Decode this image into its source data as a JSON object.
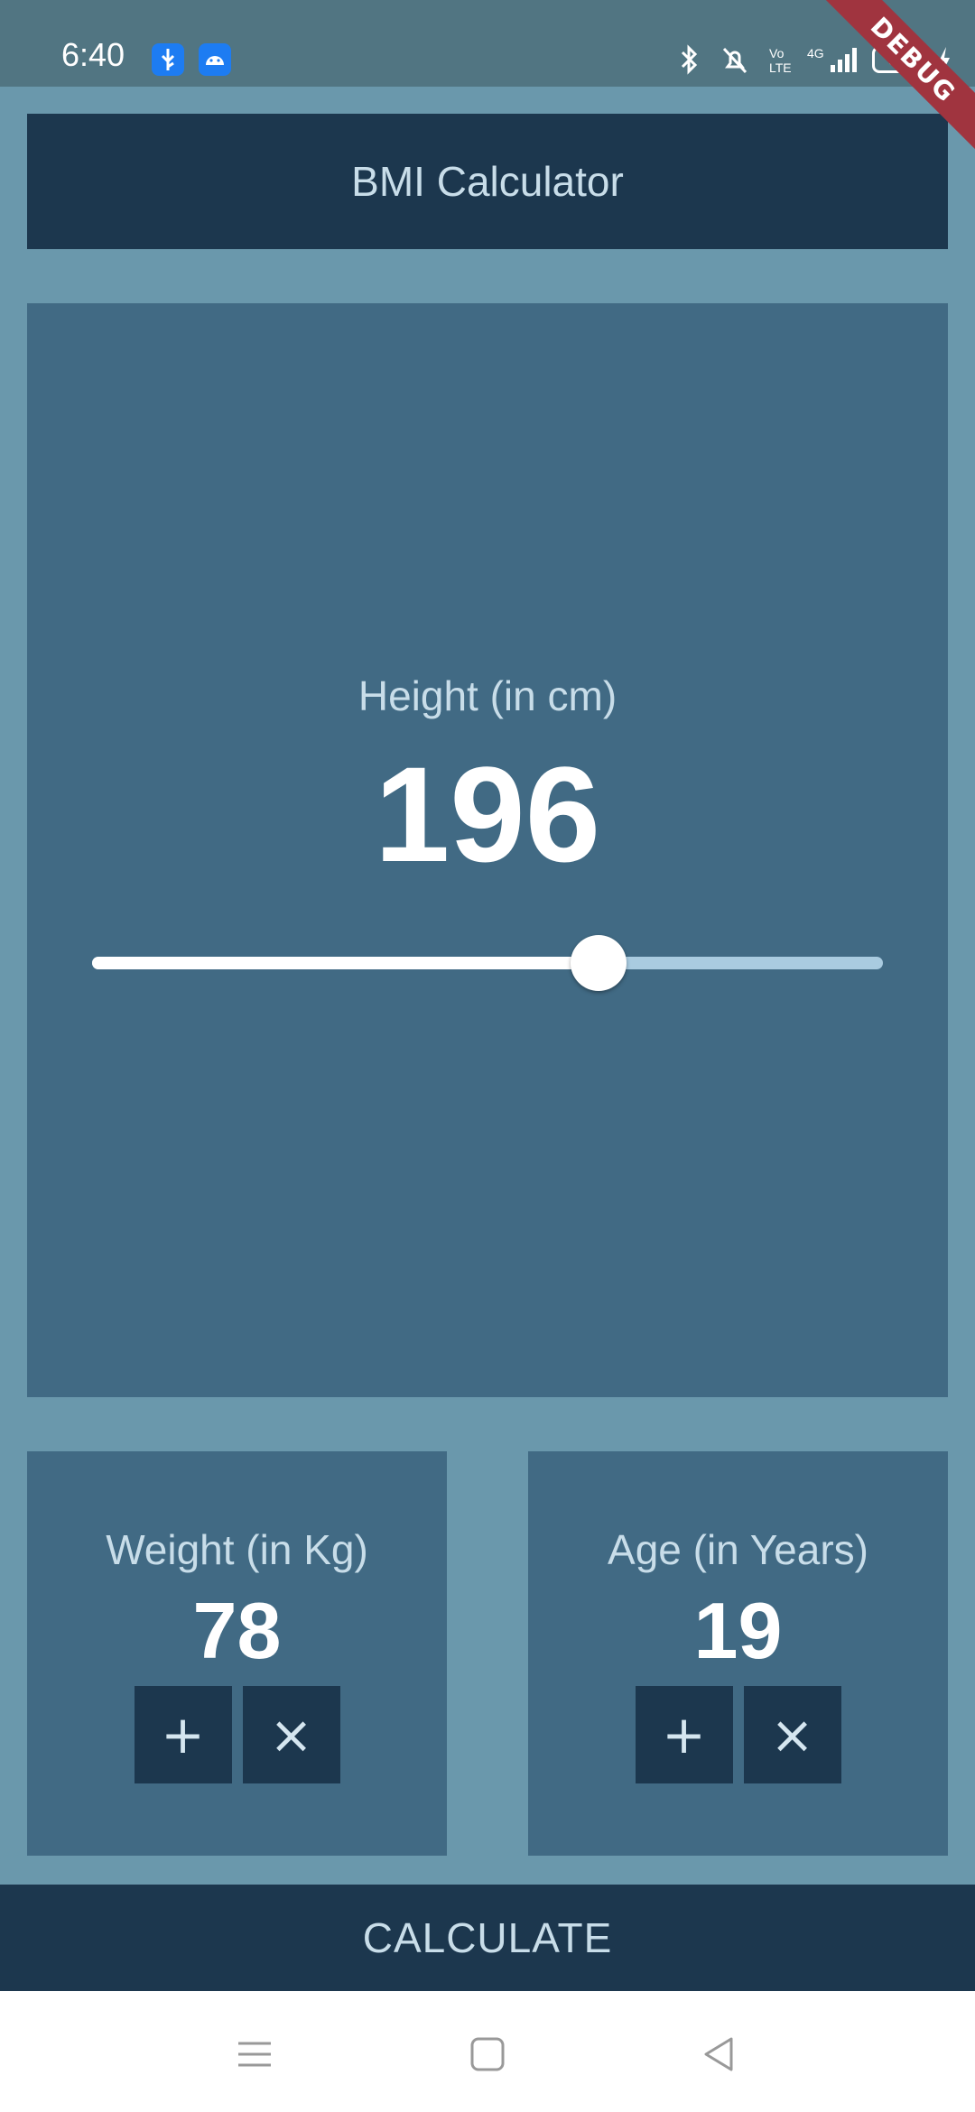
{
  "status_bar": {
    "time": "6:40",
    "battery": "52",
    "icons": [
      "usb-icon",
      "android-icon",
      "bluetooth-icon",
      "mute-icon",
      "volte-icon",
      "4g-signal-icon",
      "battery-icon"
    ]
  },
  "debug_banner": "DEBUG",
  "app_bar": {
    "title": "BMI Calculator"
  },
  "height": {
    "label": "Height (in cm)",
    "value": "196",
    "slider_fraction": 0.64
  },
  "weight": {
    "label": "Weight (in Kg)",
    "value": "78",
    "plus": "+",
    "minus": "×"
  },
  "age": {
    "label": "Age (in Years)",
    "value": "19",
    "plus": "+",
    "minus": "×"
  },
  "calculate": {
    "label": "CALCULATE"
  },
  "colors": {
    "background": "#6a98ac",
    "card": "#416a84",
    "dark": "#1c374e",
    "label_text": "#c8dde9"
  },
  "nav": {
    "icons": [
      "menu-icon",
      "home-icon",
      "back-icon"
    ]
  }
}
